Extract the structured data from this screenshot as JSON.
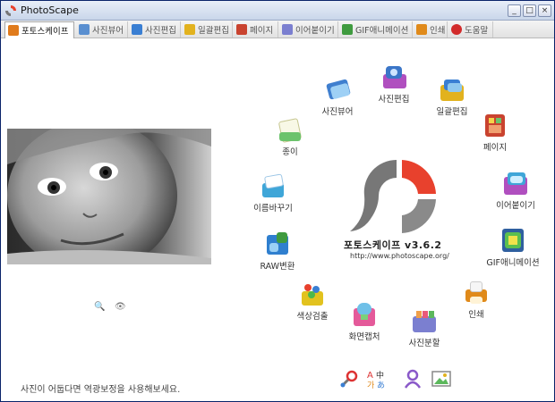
{
  "window": {
    "title": "PhotoScape"
  },
  "tabs": [
    {
      "label": "포토스케이프",
      "active": true,
      "color": "#e07b1c"
    },
    {
      "label": "사진뷰어",
      "color": "#5a8fd0"
    },
    {
      "label": "사진편집",
      "color": "#3a7fd3"
    },
    {
      "label": "일괄편집",
      "color": "#e2b21e"
    },
    {
      "label": "페이지",
      "color": "#c9432f"
    },
    {
      "label": "이어붙이기",
      "color": "#7b7fd0"
    },
    {
      "label": "GIF애니메이션",
      "color": "#3f9b3f"
    },
    {
      "label": "인쇄",
      "color": "#e08a1a"
    },
    {
      "label": "도움말",
      "color": "#d22b2b"
    }
  ],
  "launchers": {
    "viewer": "사진뷰어",
    "editor": "사진편집",
    "batch": "일괄편집",
    "page": "페이지",
    "combine": "이어붙이기",
    "gif": "GIF애니메이션",
    "print": "인쇄",
    "splitter": "사진분할",
    "screen": "화면캡처",
    "color": "색상검출",
    "raw": "RAW변환",
    "rename": "이름바꾸기",
    "paper": "종이"
  },
  "logo": {
    "version": "포토스케이프 v3.6.2",
    "url": "http://www.photoscape.org/"
  },
  "photo": {
    "small_icon_1": "🔍",
    "small_icon_2": "👁"
  },
  "tip": "사진이 어둡다면 역광보정을 사용해보세요.",
  "bottom_icons": [
    "tools-icon",
    "language-icon",
    "users-icon",
    "image-icon"
  ],
  "colors": {
    "accent_red": "#e8412d",
    "logo_gray": "#8a8a8a",
    "border": "#0a246a"
  }
}
